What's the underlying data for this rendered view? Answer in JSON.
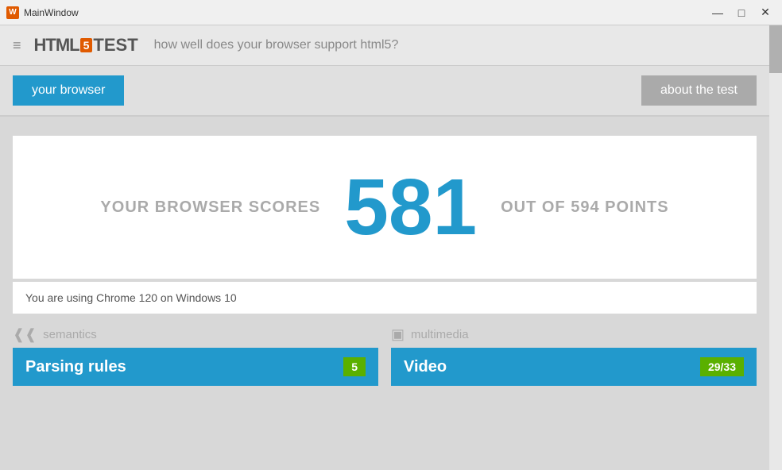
{
  "titleBar": {
    "icon": "W",
    "title": "MainWindow",
    "minimizeLabel": "—",
    "maximizeLabel": "□",
    "closeLabel": "✕"
  },
  "header": {
    "hamburgerIcon": "≡",
    "html5Label": "HTML",
    "badgeLabel": "5",
    "testLabel": "TEST",
    "tagline": "how well does your browser support html5?"
  },
  "nav": {
    "yourBrowserLabel": "your browser",
    "aboutTestLabel": "about the test"
  },
  "scoreCard": {
    "leftLabel": "YOUR BROWSER SCORES",
    "score": "581",
    "rightLabel": "OUT OF 594 POINTS"
  },
  "browserInfo": {
    "text": "You are using Chrome 120 on Windows 10"
  },
  "categories": [
    {
      "iconSymbol": "❰❰",
      "name": "semantics",
      "barLabel": "Parsing rules",
      "barScore": "5"
    },
    {
      "iconSymbol": "▣",
      "name": "multimedia",
      "barLabel": "Video",
      "barScore": "29/33"
    }
  ]
}
